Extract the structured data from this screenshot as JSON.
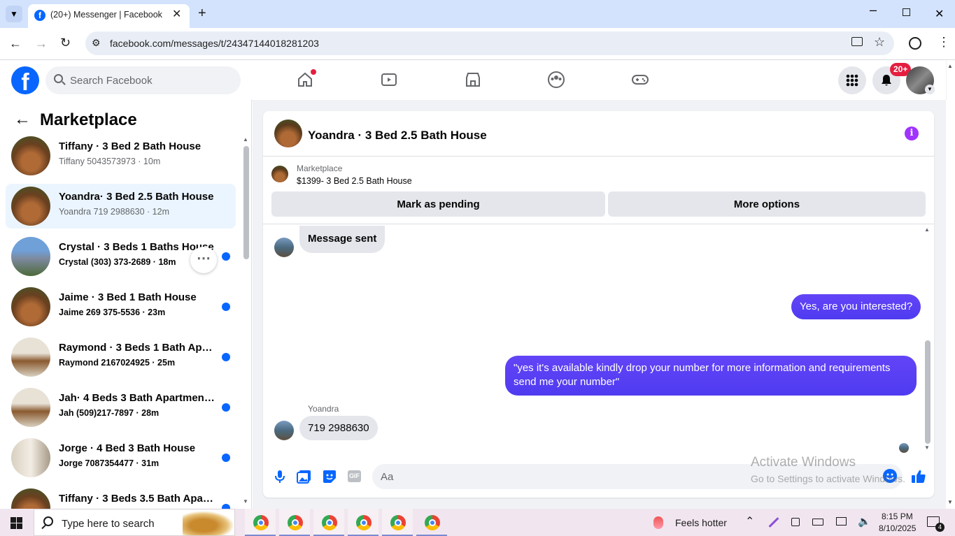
{
  "browser": {
    "tab_title": "(20+) Messenger | Facebook",
    "url": "facebook.com/messages/t/24347144018281203"
  },
  "header": {
    "search_placeholder": "Search Facebook",
    "notification_badge": "20+"
  },
  "sidebar": {
    "title": "Marketplace",
    "conversations": [
      {
        "title": "Tiffany · 3 Bed 2 Bath House",
        "subtitle": "Tiffany 5043573973 · 10m",
        "unread": false,
        "active": false
      },
      {
        "title": "Yoandra· 3 Bed 2.5 Bath House",
        "subtitle": "Yoandra 719 2988630 · 12m",
        "unread": false,
        "active": true
      },
      {
        "title": "Crystal · 3 Beds 1 Baths House",
        "subtitle": "Crystal (303) 373-2689 · 18m",
        "unread": true,
        "active": false
      },
      {
        "title": "Jaime · 3 Bed 1 Bath House",
        "subtitle": "Jaime 269 375-5536 · 23m",
        "unread": true,
        "active": false
      },
      {
        "title": "Raymond · 3 Beds 1 Bath Apar...",
        "subtitle": "Raymond 2167024925 · 25m",
        "unread": true,
        "active": false
      },
      {
        "title": "Jah· 4 Beds 3 Bath Apartment/...",
        "subtitle": "Jah (509)217-7897 · 28m",
        "unread": true,
        "active": false
      },
      {
        "title": "Jorge · 4 Bed 3 Bath House",
        "subtitle": "Jorge 7087354477 · 31m",
        "unread": true,
        "active": false
      },
      {
        "title": "Tiffany · 3 Beds 3.5 Bath Apart...",
        "subtitle": "",
        "unread": true,
        "active": false
      }
    ]
  },
  "chat": {
    "title": "Yoandra · 3 Bed 2.5 Bath House",
    "listing_label": "Marketplace",
    "listing_name": "$1399- 3 Bed 2.5 Bath House",
    "mark_pending": "Mark as pending",
    "more_options": "More options",
    "messages": {
      "m1": "Message sent",
      "m2": "Yes, are you interested?",
      "m3": "\"yes it's available kindly drop your number for more information and requirements send me your number\"",
      "sender": "Yoandra",
      "m4": "719 2988630"
    },
    "composer_placeholder": "Aa"
  },
  "watermark": {
    "line1": "Activate Windows",
    "line2": "Go to Settings to activate Windows."
  },
  "taskbar": {
    "search_placeholder": "Type here to search",
    "weather": "Feels hotter",
    "time": "8:15 PM",
    "date": "8/10/2025",
    "notif_count": "4"
  },
  "colors": {
    "fb_blue": "#0866ff",
    "messenger_purple": "#5b3cf3",
    "badge_red": "#e41e3f"
  }
}
